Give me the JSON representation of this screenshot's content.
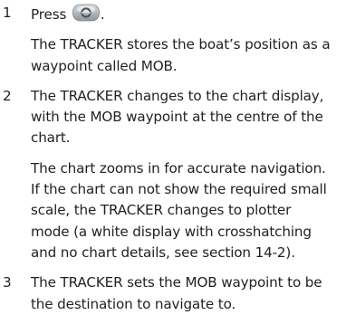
{
  "steps": [
    {
      "number": "1",
      "press_text": "Press",
      "press_suffix": ".",
      "key_icon": "mob-key-icon",
      "paragraphs": [
        [
          "The TRACKER stores the boat’s position as a",
          "waypoint called MOB."
        ]
      ]
    },
    {
      "number": "2",
      "paragraphs": [
        [
          "The TRACKER changes to the chart display,",
          "with the MOB waypoint at the centre of the",
          "chart."
        ],
        [
          "The chart zooms in for accurate navigation.",
          "If the chart can not show the required small",
          "scale, the TRACKER changes to plotter",
          "mode (a white display with crosshatching",
          "and no chart details, see section 14-2)."
        ]
      ]
    },
    {
      "number": "3",
      "paragraphs": [
        [
          "The TRACKER sets the MOB waypoint to be",
          "the destination to navigate to."
        ]
      ]
    }
  ]
}
